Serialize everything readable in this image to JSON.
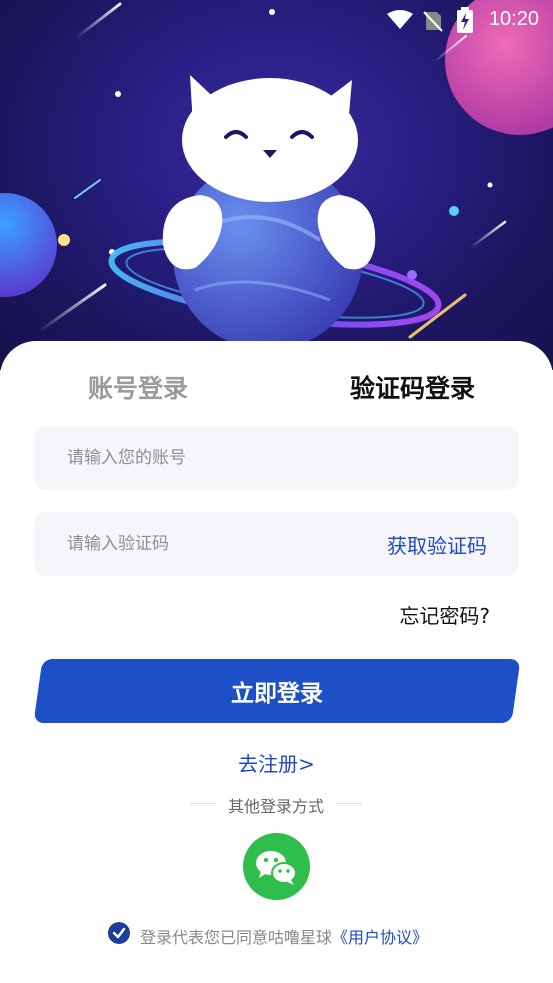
{
  "status_bar": {
    "time": "10:20"
  },
  "tabs": {
    "account_label": "账号登录",
    "code_label": "验证码登录"
  },
  "form": {
    "account_placeholder": "请输入您的账号",
    "code_placeholder": "请输入验证码",
    "get_code_label": "获取验证码",
    "forgot_label": "忘记密码?",
    "login_label": "立即登录",
    "register_label": "去注册>"
  },
  "other_login": {
    "label": "其他登录方式",
    "wechat_icon": "wechat-icon"
  },
  "agreement": {
    "prefix": "登录代表您已同意咕噜星球",
    "link": "《用户协议》",
    "checked": true
  },
  "colors": {
    "accent": "#1d4fc6",
    "hero_bg": "#2a1f86",
    "wechat": "#2fbe4c"
  }
}
